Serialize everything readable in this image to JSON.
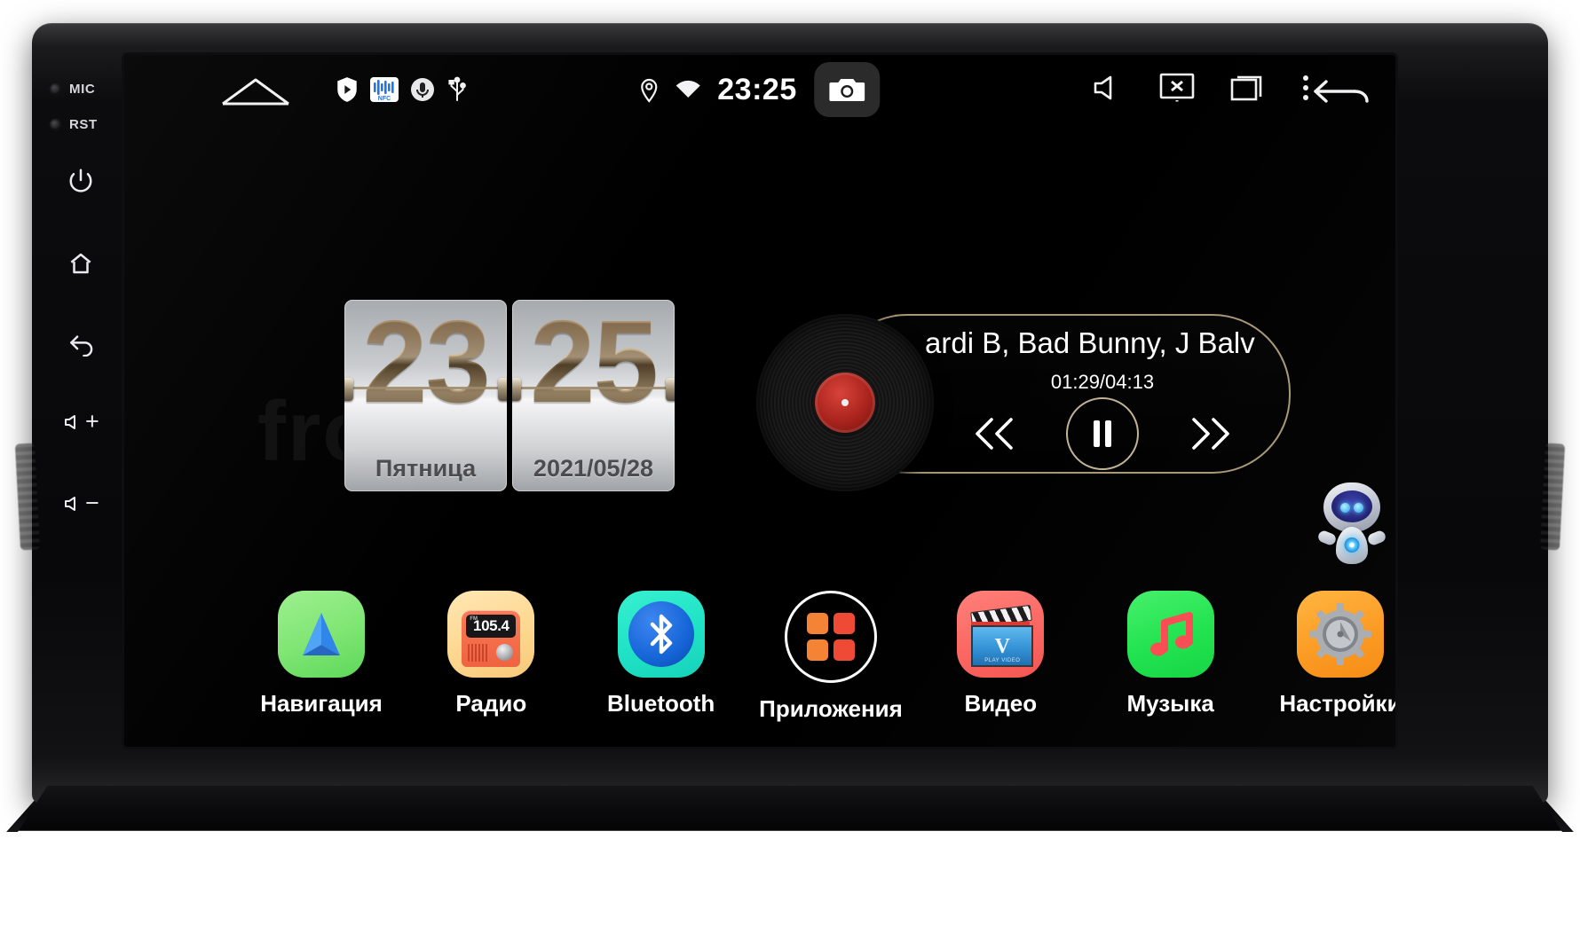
{
  "device": {
    "bezel": {
      "leds": [
        {
          "name": "mic-led",
          "label": "MIC"
        },
        {
          "name": "rst-led",
          "label": "RST"
        }
      ],
      "buttons": [
        {
          "name": "power-button",
          "icon": "power-icon"
        },
        {
          "name": "home-button",
          "icon": "home-icon"
        },
        {
          "name": "back-button",
          "icon": "back-arrow-icon"
        },
        {
          "name": "volume-up-button",
          "icon": "volume-up-icon",
          "label": "+"
        },
        {
          "name": "volume-down-button",
          "icon": "volume-down-icon",
          "label": "−"
        }
      ]
    }
  },
  "statusbar": {
    "home_icon": "home-outline-icon",
    "left_icons": [
      "play-shield-icon",
      "nfc-icon",
      "mic-circle-icon",
      "usb-icon"
    ],
    "location_icon": "location-pin-icon",
    "wifi_icon": "wifi-icon",
    "time": "23:25",
    "camera_icon": "camera-icon",
    "volume_icon": "speaker-icon",
    "screen_off_icon": "screen-off-icon",
    "recents_icon": "recent-apps-icon",
    "overflow_icon": "more-vertical-icon",
    "back_icon": "back-arrow-icon"
  },
  "clock_widget": {
    "hours": "23",
    "minutes": "25",
    "weekday": "Пятница",
    "date": "2021/05/28"
  },
  "player": {
    "track_title": "ardi B, Bad Bunny, J Balv",
    "time": "01:29/04:13",
    "prev_icon": "skip-previous-icon",
    "play_icon": "pause-icon",
    "next_icon": "skip-next-icon",
    "vinyl_icon": "vinyl-record-icon"
  },
  "assistant": {
    "name": "assistant-robot-icon"
  },
  "watermark": "front",
  "dock": {
    "apps": [
      {
        "label": "Навигация",
        "icon": "navigation-icon",
        "name": "app-navigation"
      },
      {
        "label": "Радио",
        "icon": "radio-icon",
        "name": "app-radio",
        "frequency": "105.4",
        "band": "FM"
      },
      {
        "label": "Bluetooth",
        "icon": "bluetooth-icon",
        "name": "app-bluetooth"
      },
      {
        "label": "Приложения",
        "icon": "apps-grid-icon",
        "name": "app-applications"
      },
      {
        "label": "Видео",
        "icon": "video-icon",
        "name": "app-video",
        "badge": "V",
        "badge_sub": "PLAY VIDEO"
      },
      {
        "label": "Музыка",
        "icon": "music-note-icon",
        "name": "app-music"
      },
      {
        "label": "Настройки",
        "icon": "settings-gear-icon",
        "name": "app-settings"
      }
    ]
  },
  "colors": {
    "nav_green": "#7ee572",
    "radio_cream": "#fdd68e",
    "bluetooth_cyan": "#21e3c6",
    "apps_orange": "#f4743a",
    "video_red": "#fb6661",
    "music_green": "#1fe34e",
    "settings_orange": "#fb9a1f",
    "clock_gold": "#c3a881",
    "ring_gold": "#c7b28c"
  }
}
